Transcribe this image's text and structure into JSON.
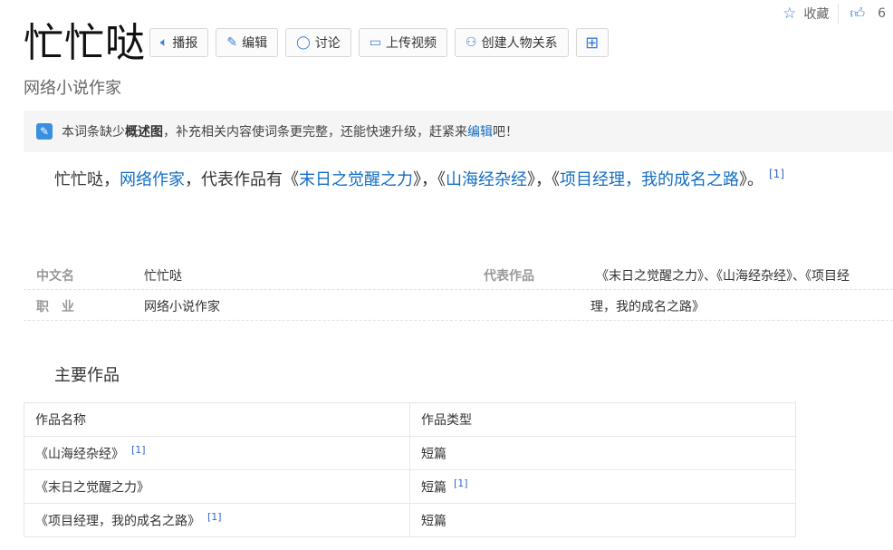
{
  "header": {
    "title": "忙忙哒",
    "subtitle": "网络小说作家",
    "collect_label": "收藏",
    "like_count": "6",
    "toolbar": {
      "play_label": "播报",
      "edit_label": "编辑",
      "discuss_label": "讨论",
      "upload_video_label": "上传视频",
      "create_relation_label": "创建人物关系"
    }
  },
  "notice": {
    "prefix": "本词条缺少",
    "bold": "概述图",
    "middle": "，补充相关内容使词条更完整，还能快速升级，赶紧来",
    "link": "编辑",
    "suffix": "吧！"
  },
  "summary": {
    "part1": "忙忙哒，",
    "link1": "网络作家",
    "part2": "，代表作品有《",
    "link2": "末日之觉醒之力",
    "part3": "》，《",
    "link3": "山海经杂经",
    "part4": "》，《",
    "link4": "项目经理，我的成名之路",
    "part5": "》。",
    "ref": "[1]"
  },
  "basic_info": {
    "name_label": "中文名",
    "name_value": "忙忙哒",
    "job_label": "职　业",
    "job_value": "网络小说作家",
    "works_label": "代表作品",
    "works_value_line1": "《末日之觉醒之力》、《山海经杂经》、《项目经",
    "works_value_line2": "理，我的成名之路》"
  },
  "works_section": {
    "title": "主要作品",
    "headers": [
      "作品名称",
      "作品类型"
    ],
    "rows": [
      {
        "name": "《山海经杂经》",
        "name_ref": "[1]",
        "type": "短篇",
        "type_ref": ""
      },
      {
        "name": "《末日之觉醒之力》",
        "name_ref": "",
        "type": "短篇",
        "type_ref": "[1]"
      },
      {
        "name": "《项目经理，我的成名之路》",
        "name_ref": "[1]",
        "type": "短篇",
        "type_ref": ""
      }
    ]
  }
}
